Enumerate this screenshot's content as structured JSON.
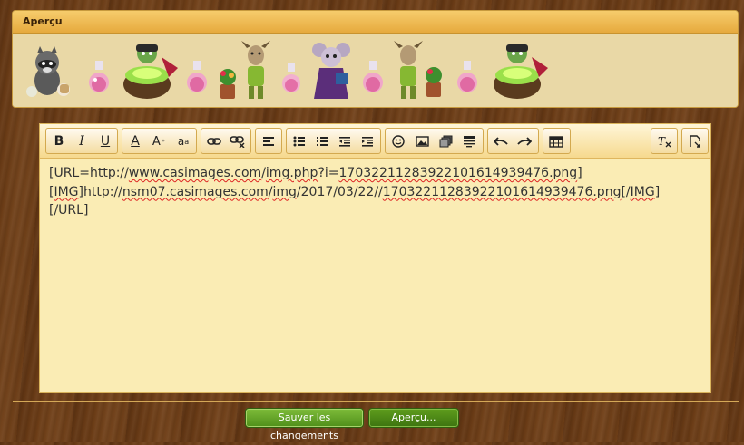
{
  "preview": {
    "title": "Aperçu"
  },
  "editor": {
    "toolbar": {
      "bold": "B",
      "italic": "I",
      "underline": "U",
      "font_color": "A",
      "font_size": "A",
      "font_face": "a"
    },
    "content_lines": [
      [
        {
          "t": "[URL=http://",
          "sq": false
        },
        {
          "t": "www.casimages.com",
          "sq": true
        },
        {
          "t": "/",
          "sq": false
        },
        {
          "t": "img.php",
          "sq": true
        },
        {
          "t": "?i=",
          "sq": false
        },
        {
          "t": "17032211283922101614939476.png",
          "sq": true
        },
        {
          "t": "]",
          "sq": false
        }
      ],
      [
        {
          "t": "[",
          "sq": false
        },
        {
          "t": "IMG",
          "sq": true
        },
        {
          "t": "]http://",
          "sq": false
        },
        {
          "t": "nsm07.casimages.com",
          "sq": true
        },
        {
          "t": "/",
          "sq": false
        },
        {
          "t": "img",
          "sq": true
        },
        {
          "t": "/2017/03/22//",
          "sq": false
        },
        {
          "t": "17032211283922101614939476.png",
          "sq": true
        },
        {
          "t": "[/",
          "sq": false
        },
        {
          "t": "IMG",
          "sq": true
        },
        {
          "t": "]",
          "sq": false
        }
      ],
      [
        {
          "t": "[/URL]",
          "sq": false
        }
      ]
    ]
  },
  "buttons": {
    "save": "Sauver les changements",
    "preview": "Aperçu..."
  },
  "colors": {
    "panel_header": "#e6aa3e",
    "editor_bg": "#faecb4",
    "button_green": "#4f8f1a",
    "wood": "#6b3c16"
  }
}
